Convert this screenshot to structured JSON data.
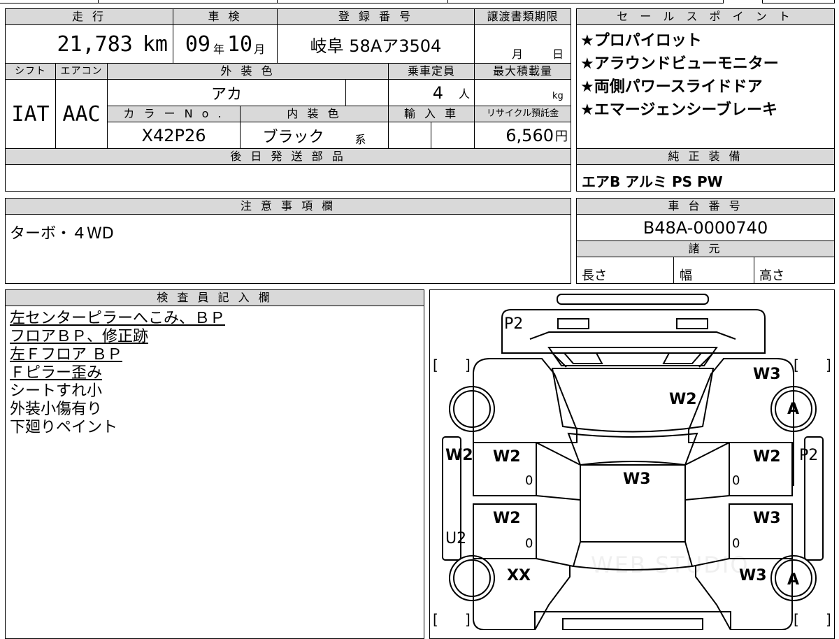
{
  "top_table": {
    "headers": {
      "mileage": "走 行",
      "inspection": "車 検",
      "registration": "登 録 番 号",
      "transfer_deadline": "譲渡書類期限",
      "shift": "シフト",
      "aircon": "エアコン",
      "exterior_color": "外 装 色",
      "capacity": "乗車定員",
      "max_load": "最大積載量",
      "color_no": "カ ラ ー N o .",
      "interior_color": "内 装 色",
      "import": "輸 入 車",
      "recycle": "リサイクル預託金",
      "later_parts": "後 日 発 送 部 品"
    },
    "mileage_value": "21,783",
    "mileage_unit": "km",
    "inspection_year": "09",
    "inspection_year_unit": "年",
    "inspection_month": "10",
    "inspection_month_unit": "月",
    "registration_number": "岐阜 58Aア3504",
    "transfer_month_unit": "月",
    "transfer_day_unit": "日",
    "shift_value": "IAT",
    "aircon_value": "AAC",
    "exterior_color_value": "アカ",
    "capacity_value": "4",
    "capacity_unit": "人",
    "max_load_unit": "kg",
    "color_no_value": "X42P26",
    "interior_color_value": "ブラック",
    "interior_color_suffix": "系",
    "recycle_value": "6,560",
    "recycle_unit": "円"
  },
  "sales_points": {
    "header": "セ ー ル ス ポ イ ン ト",
    "items": [
      "★プロパイロット",
      "★アラウンドビューモニター",
      "★両側パワースライドドア",
      "★エマージェンシーブレーキ"
    ]
  },
  "genuine_equipment": {
    "header": "純 正 装 備",
    "value": "エアB アルミ PS PW"
  },
  "notes": {
    "header": "注 意 事 項 欄",
    "value": "ターボ・４WD"
  },
  "chassis": {
    "header": "車 台 番 号",
    "value": "B48A-0000740"
  },
  "specs": {
    "header": "諸 元",
    "length": "長さ",
    "width": "幅",
    "height": "高さ"
  },
  "inspector": {
    "header": "検 査 員 記 入 欄",
    "lines": [
      {
        "text": "左センターピラーへこみ、ＢＰ",
        "underline": true
      },
      {
        "text": "フロアＢＰ、修正跡",
        "underline": true
      },
      {
        "text": "左Ｆフロア ＢＰ",
        "underline": true
      },
      {
        "text": "Ｆピラー歪み",
        "underline": true
      },
      {
        "text": "シートすれ小",
        "underline": false
      },
      {
        "text": "外装小傷有り",
        "underline": false
      },
      {
        "text": "下廻りペイント",
        "underline": false
      }
    ]
  },
  "diagram": {
    "marks": {
      "front_bumper": "P2",
      "hood": "W2",
      "right_front_fender": "W3",
      "right_front_tire": "A",
      "left_front_fender_edge": "W2",
      "left_front_door": "W2",
      "left_front_door_num": "0",
      "roof": "W3",
      "right_front_door": "W2",
      "right_front_door_num": "0",
      "right_side_edge": "P2",
      "left_rear_door": "W2",
      "left_rear_door_num": "0",
      "right_rear_door": "W3",
      "right_rear_door_num": "0",
      "left_side_lower": "U2",
      "left_rear_fender": "XX",
      "right_rear_fender": "W3",
      "right_rear_tire": "A"
    },
    "bracket": "[ ]",
    "watermark": "WEB STUDIO"
  }
}
